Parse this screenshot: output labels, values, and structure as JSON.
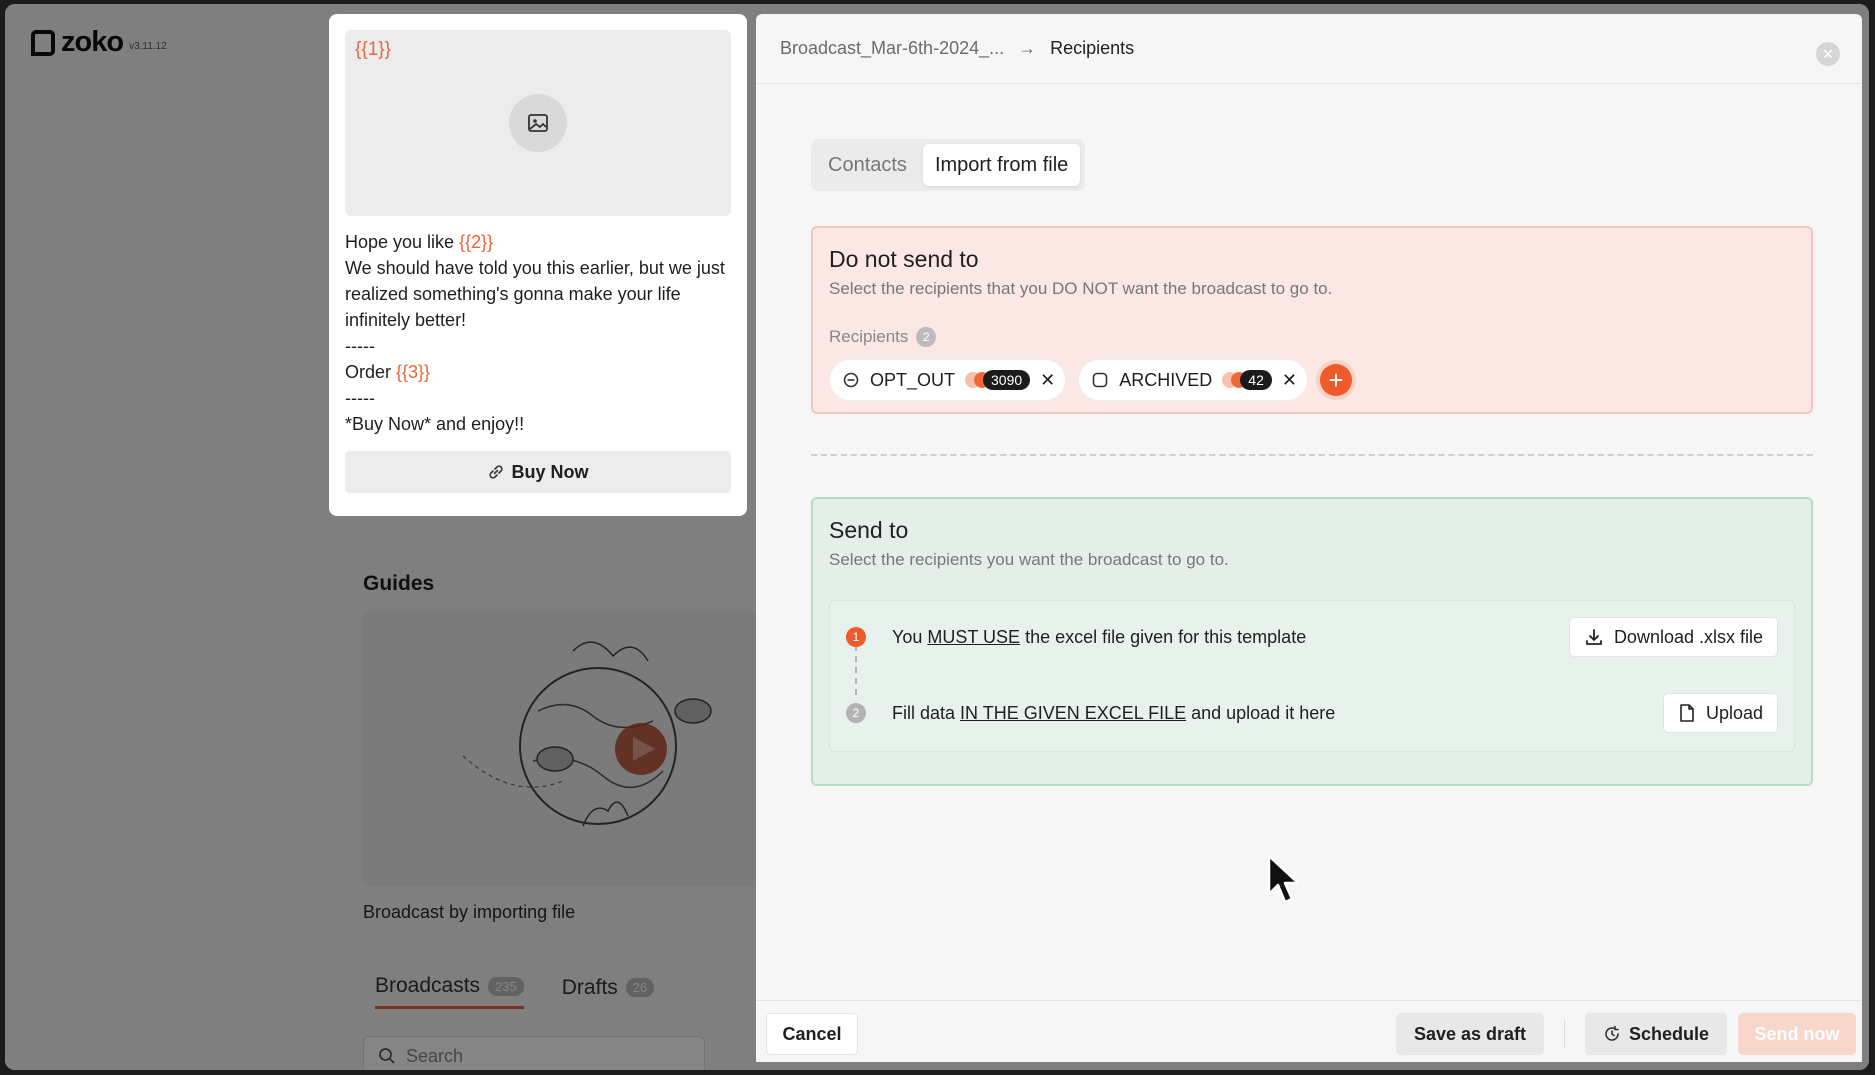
{
  "app": {
    "name": "zoko",
    "version": "v3.11.12"
  },
  "background": {
    "guides_title": "Guides",
    "guide_caption": "Broadcast by importing file",
    "tabs": [
      {
        "label": "Broadcasts",
        "count": "235"
      },
      {
        "label": "Drafts",
        "count": "26"
      }
    ],
    "search_placeholder": "Search"
  },
  "preview": {
    "media_var": "{{1}}",
    "line1_text": "Hope you like ",
    "line1_var": "{{2}}",
    "body": "We should have told you this earlier, but we just realized something's gonna make your life infinitely better!",
    "sep1": "-----",
    "order_text": "Order ",
    "order_var": "{{3}}",
    "sep2": "-----",
    "closing": "*Buy Now* and enjoy!!",
    "button_label": "Buy Now"
  },
  "panel": {
    "breadcrumb": {
      "parent": "Broadcast_Mar-6th-2024_...",
      "current": "Recipients"
    },
    "tabs": [
      {
        "label": "Contacts"
      },
      {
        "label": "Import from file"
      }
    ],
    "do_not_send": {
      "title": "Do not send to",
      "subtitle": "Select the recipients that you DO NOT want the broadcast to go to.",
      "recipients_label": "Recipients",
      "recipients_count": "2",
      "chips": [
        {
          "label": "OPT_OUT",
          "count": "3090"
        },
        {
          "label": "ARCHIVED",
          "count": "42"
        }
      ]
    },
    "send_to": {
      "title": "Send to",
      "subtitle": "Select the recipients you want the broadcast to go to.",
      "step1": {
        "num": "1",
        "pre": "You",
        "em": "MUST USE",
        "post": "the excel file given for this template",
        "button": "Download .xlsx file"
      },
      "step2": {
        "num": "2",
        "pre": "Fill data",
        "em": "IN THE GIVEN EXCEL FILE",
        "post": "and upload it here",
        "button": "Upload"
      }
    },
    "footer": {
      "cancel": "Cancel",
      "save_draft": "Save as draft",
      "schedule": "Schedule",
      "send_now": "Send now"
    }
  },
  "colors": {
    "accent": "#ef5a2a",
    "danger_bg": "#fbe7e3",
    "success_bg": "#e3efe8"
  }
}
